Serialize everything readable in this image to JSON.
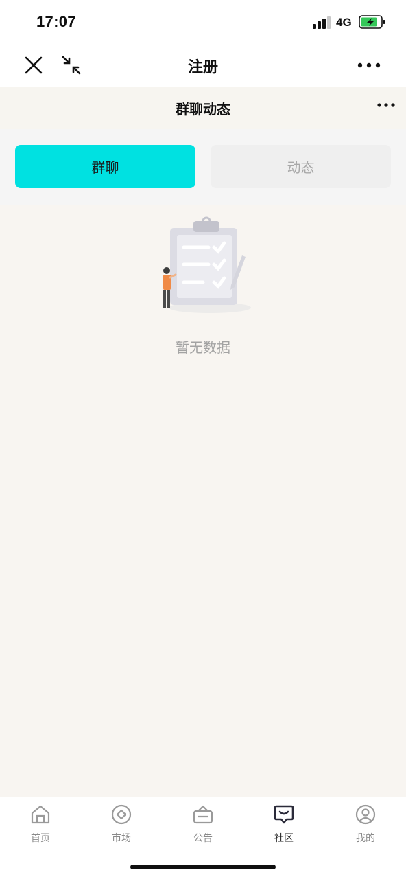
{
  "status": {
    "time": "17:07",
    "network": "4G",
    "battery_color": "#34c759"
  },
  "nav": {
    "title": "注册",
    "icons": [
      "close-icon",
      "minimize-icon",
      "more-icon"
    ]
  },
  "header": {
    "title": "群聊动态",
    "more_icon": "more-icon"
  },
  "tabs": [
    {
      "label": "群聊",
      "active": true
    },
    {
      "label": "动态",
      "active": false
    }
  ],
  "empty": {
    "text": "暂无数据",
    "illustration": "clipboard-empty-icon"
  },
  "tabbar": {
    "items": [
      {
        "label": "首页",
        "icon": "home-icon",
        "active": false
      },
      {
        "label": "市场",
        "icon": "market-icon",
        "active": false
      },
      {
        "label": "公告",
        "icon": "announcement-icon",
        "active": false
      },
      {
        "label": "社区",
        "icon": "community-icon",
        "active": true
      },
      {
        "label": "我的",
        "icon": "profile-icon",
        "active": false
      }
    ]
  },
  "colors": {
    "accent": "#00e1e1",
    "background": "#f8f5f1"
  }
}
